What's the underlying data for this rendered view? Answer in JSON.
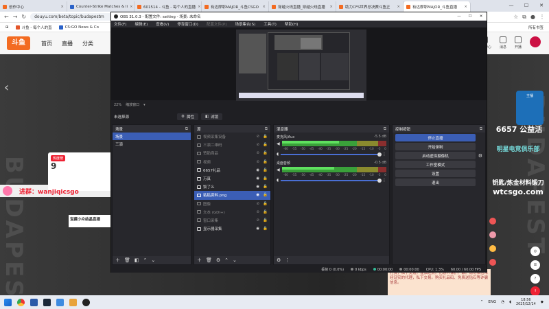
{
  "browser": {
    "tabs": [
      {
        "label": "创作中心",
        "color": "#f36b21",
        "active": false
      },
      {
        "label": "Counter-Strike Matches & li",
        "color": "#2a62c9",
        "active": false
      },
      {
        "label": "601514 - 斗鱼 - 每个人的直播",
        "color": "#f36b21",
        "active": false
      },
      {
        "label": "有达摩耶MAJOR_斗鱼CSGO",
        "color": "#f36b21",
        "active": false
      },
      {
        "label": "穿越火线直播_穿越火线直播",
        "color": "#f36b21",
        "active": false
      },
      {
        "label": "助力CFS世界总决赛斗鱼正",
        "color": "#f36b21",
        "active": false
      },
      {
        "label": "有达摩耶MAJOR_斗鱼直播",
        "color": "#f36b21",
        "active": true
      }
    ],
    "url": "douyu.com/beta/topic/budapestm",
    "bookmarks": [
      "斗鱼 - 每个人的直",
      "CS:GO News & Co"
    ],
    "bookmarks_right": "所有书签"
  },
  "douyu": {
    "nav": [
      "首页",
      "直播",
      "分类"
    ],
    "right_items": [
      "下载",
      "历史",
      "关注",
      "创作中心",
      "消息",
      "开播"
    ],
    "streamer_tag": "热度榜",
    "streamer_num": "9",
    "promo_text": "进群：wanjiqicsgo",
    "room_title": "宝藏小众结晶直播",
    "right_badge": "主播",
    "right_promo1": "6657 公益活",
    "right_promo2": "明星电竞俱乐部",
    "right_promo3a": "钥匙/炼金材料锻刀",
    "right_promo3b": "wtcsgo.com",
    "chat_text": "打赏，私下交易，谨慎理财。亿游人保护产品。请勿相信未经证实的代理，私下交易。购买礼品码、免费送钻石等诈骗信息。"
  },
  "obs": {
    "title": "OBS 31.0.3 - 配置文件: setting - 场景: 未命名",
    "menu": [
      "文件(F)",
      "编辑(E)",
      "查看(V)",
      "停靠窗口(D)",
      "配置文件(P)",
      "场景集合(S)",
      "工具(T)",
      "帮助(H)"
    ],
    "menu_dim": [
      false,
      false,
      false,
      false,
      true,
      false,
      false,
      false
    ],
    "zoom": "22%",
    "zoom_mode": "缩放窗口",
    "scene_label": "未选择源",
    "props_btn": "属性",
    "filters_btn": "滤镜",
    "scenes_title": "场景",
    "scenes": [
      {
        "name": "场景",
        "selected": true
      },
      {
        "name": "三演",
        "selected": false
      }
    ],
    "sources_title": "源",
    "sources": [
      {
        "name": "视频采集设备",
        "visible": false,
        "selected": false
      },
      {
        "name": "三演二维码",
        "visible": false,
        "selected": false
      },
      {
        "name": "赞助商品",
        "visible": false,
        "selected": false
      },
      {
        "name": "视频",
        "visible": false,
        "selected": false
      },
      {
        "name": "6657礼品",
        "visible": true,
        "selected": false
      },
      {
        "name": "万真",
        "visible": true,
        "selected": false
      },
      {
        "name": "饭了么",
        "visible": true,
        "selected": false
      },
      {
        "name": "粘贴资料.png",
        "visible": true,
        "selected": true
      },
      {
        "name": "图像",
        "visible": false,
        "selected": false
      },
      {
        "name": "文本 (GDI+)",
        "visible": false,
        "selected": false
      },
      {
        "name": "窗口采集",
        "visible": false,
        "selected": false
      },
      {
        "name": "显示器采集",
        "visible": true,
        "selected": false
      }
    ],
    "mixer_title": "混音器",
    "mixer": [
      {
        "name": "麦克风/Aux",
        "db": "-5.5 dB",
        "level": 0.55
      },
      {
        "name": "桌面音频",
        "db": "-0.5 dB",
        "level": 0.5
      }
    ],
    "ticks": [
      "-60",
      "-55",
      "-50",
      "-45",
      "-40",
      "-35",
      "-30",
      "-25",
      "-20",
      "-15",
      "-10",
      "-5",
      "0"
    ],
    "controls_title": "控制按钮",
    "controls": [
      "停止直播",
      "开始录制",
      "启动虚拟摄像机",
      "工作室模式",
      "设置",
      "退出"
    ],
    "status": {
      "dropped": "丢帧 0 (0.0%)",
      "bitrate": "0 kbps",
      "live": "00:00:00",
      "rec": "00:00:00",
      "cpu": "CPU: 1.3%",
      "fps": "60.00 / 60.00 FPS"
    }
  },
  "taskbar": {
    "lang": "ENG",
    "time": "18:56",
    "date": "2025/12/14"
  },
  "colors": {
    "obs_accent": "#3b5eb5",
    "douyu_brand": "#f36b21"
  }
}
